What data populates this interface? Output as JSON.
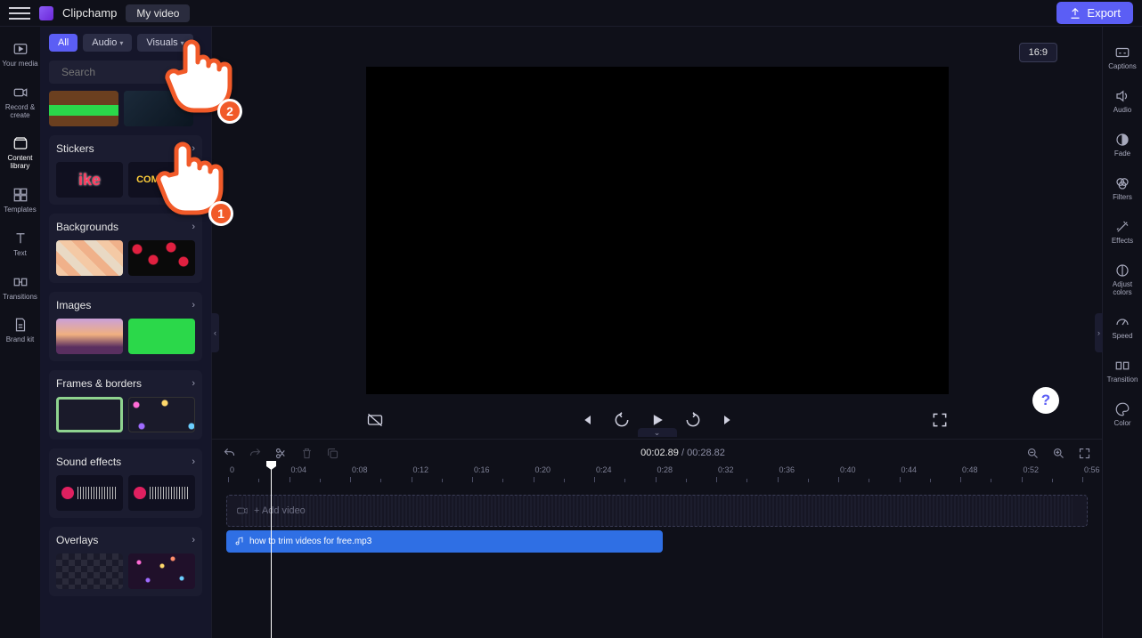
{
  "header": {
    "brand": "Clipchamp",
    "project": "My video",
    "export": "Export"
  },
  "toolstrip": [
    {
      "id": "your-media",
      "label": "Your media"
    },
    {
      "id": "record-create",
      "label": "Record & create"
    },
    {
      "id": "content-library",
      "label": "Content library"
    },
    {
      "id": "templates",
      "label": "Templates"
    },
    {
      "id": "text",
      "label": "Text"
    },
    {
      "id": "transitions",
      "label": "Transitions"
    },
    {
      "id": "brand-kit",
      "label": "Brand kit"
    }
  ],
  "panel": {
    "filters": {
      "all": "All",
      "audio": "Audio",
      "visuals": "Visuals"
    },
    "search_placeholder": "Search",
    "sections": [
      {
        "id": "stickers",
        "title": "Stickers"
      },
      {
        "id": "backgrounds",
        "title": "Backgrounds"
      },
      {
        "id": "images",
        "title": "Images"
      },
      {
        "id": "frames",
        "title": "Frames & borders"
      },
      {
        "id": "sfx",
        "title": "Sound effects"
      },
      {
        "id": "overlays",
        "title": "Overlays"
      }
    ]
  },
  "preview": {
    "ratio": "16:9"
  },
  "propstrip": [
    {
      "id": "captions",
      "label": "Captions"
    },
    {
      "id": "audio",
      "label": "Audio"
    },
    {
      "id": "fade",
      "label": "Fade"
    },
    {
      "id": "filters",
      "label": "Filters"
    },
    {
      "id": "effects",
      "label": "Effects"
    },
    {
      "id": "adjust",
      "label": "Adjust colors"
    },
    {
      "id": "speed",
      "label": "Speed"
    },
    {
      "id": "transition",
      "label": "Transition"
    },
    {
      "id": "color",
      "label": "Color"
    }
  ],
  "timeline": {
    "current": "00:02.89",
    "duration": "00:28.82",
    "add_video": "+ Add video",
    "audio_clip": "how to trim videos for free.mp3",
    "ticks": [
      "0",
      "0:04",
      "0:08",
      "0:12",
      "0:16",
      "0:20",
      "0:24",
      "0:28",
      "0:32",
      "0:36",
      "0:40",
      "0:44",
      "0:48",
      "0:52",
      "0:56"
    ]
  },
  "annotations": {
    "first": "1",
    "second": "2"
  }
}
